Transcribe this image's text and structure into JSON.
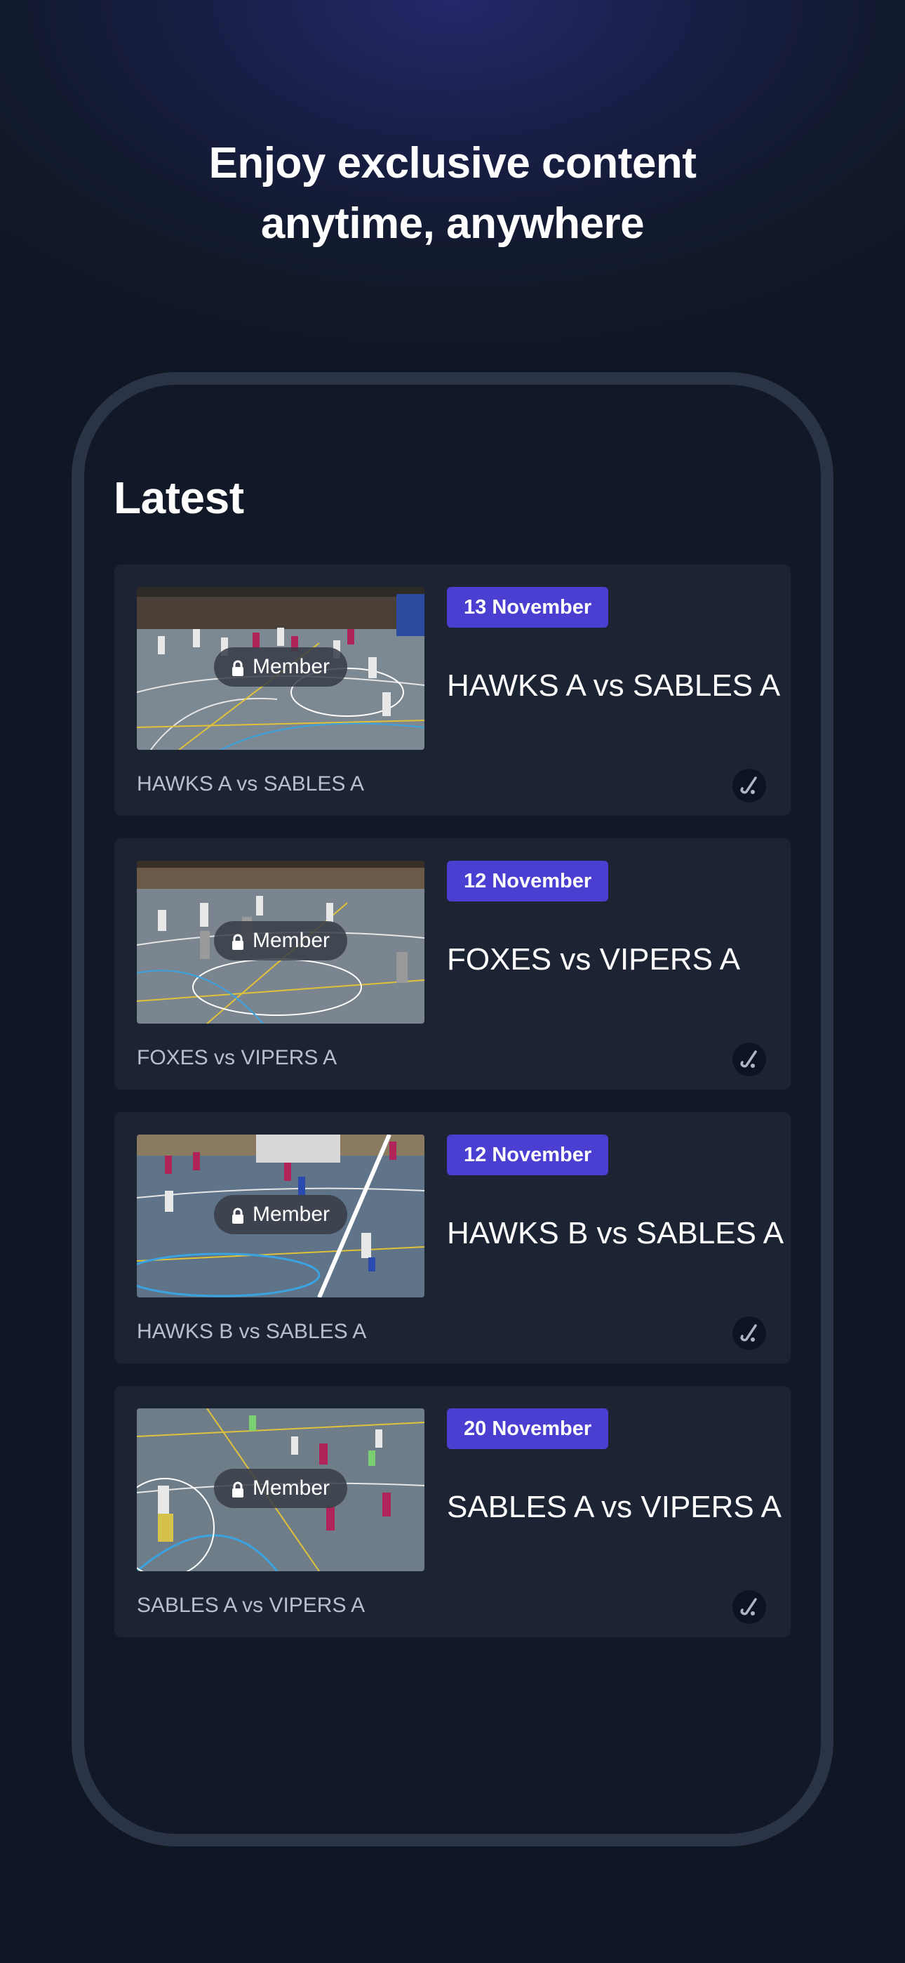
{
  "promo": {
    "headline_line1": "Enjoy exclusive content",
    "headline_line2": "anytime, anywhere"
  },
  "app": {
    "section_title": "Latest",
    "items": [
      {
        "date": "13 November",
        "title": "HAWKS A vs SABLES A",
        "subtitle": "HAWKS A vs SABLES A",
        "badge": "Member",
        "sport_icon": "hockey-stick-icon"
      },
      {
        "date": "12 November",
        "title": "FOXES vs VIPERS A",
        "subtitle": "FOXES vs VIPERS A",
        "badge": "Member",
        "sport_icon": "hockey-stick-icon"
      },
      {
        "date": "12 November",
        "title": "HAWKS B vs SABLES A",
        "subtitle": "HAWKS B vs SABLES A",
        "badge": "Member",
        "sport_icon": "hockey-stick-icon"
      },
      {
        "date": "20 November",
        "title": "SABLES A vs VIPERS A",
        "subtitle": "SABLES A vs VIPERS A",
        "badge": "Member",
        "sport_icon": "hockey-stick-icon"
      }
    ]
  },
  "colors": {
    "background": "#0f1624",
    "card": "#1c2434",
    "date_pill": "#4a3fd0",
    "phone_frame": "#2a3446",
    "subtitle_text": "#b6bfcf"
  }
}
